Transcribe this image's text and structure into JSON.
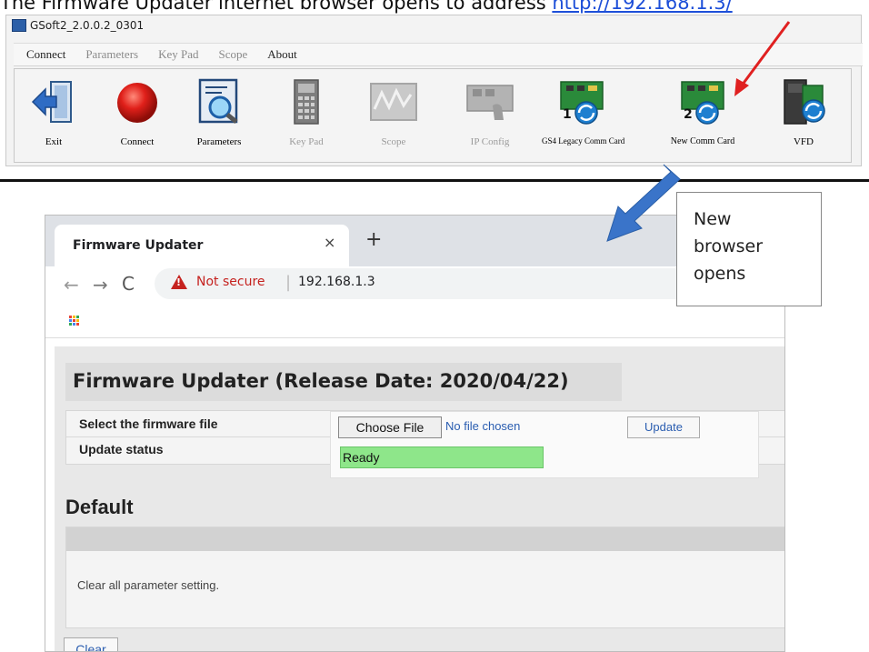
{
  "caption": {
    "text": "The Firmware Updater internet browser opens to address ",
    "link": "http://192.168.1.3/"
  },
  "gsoft": {
    "window_title": "GSoft2_2.0.0.2_0301",
    "menu": [
      {
        "label": "Connect",
        "enabled": true
      },
      {
        "label": "Parameters",
        "enabled": false
      },
      {
        "label": "Key Pad",
        "enabled": false
      },
      {
        "label": "Scope",
        "enabled": false
      },
      {
        "label": "About",
        "enabled": true
      }
    ],
    "toolbar": [
      {
        "label": "Exit",
        "icon": "exit-door-icon",
        "enabled": true
      },
      {
        "label": "Connect",
        "icon": "red-ball-icon",
        "enabled": true
      },
      {
        "label": "Parameters",
        "icon": "parameters-magnifier-icon",
        "enabled": true
      },
      {
        "label": "Key Pad",
        "icon": "keypad-icon",
        "enabled": false
      },
      {
        "label": "Scope",
        "icon": "scope-icon",
        "enabled": false
      },
      {
        "label": "IP Config",
        "icon": "ip-config-icon",
        "enabled": false
      },
      {
        "label": "GS4 Legacy Comm Card",
        "icon": "comm-card-1-icon",
        "badge": "1",
        "enabled": true
      },
      {
        "label": "New Comm Card",
        "icon": "comm-card-2-icon",
        "badge": "2",
        "enabled": true
      },
      {
        "label": "VFD",
        "icon": "vfd-icon",
        "enabled": true
      }
    ]
  },
  "browser": {
    "tab_title": "Firmware Updater",
    "tab_close": "×",
    "new_tab": "+",
    "nav": {
      "back": "←",
      "forward": "→",
      "reload": "C"
    },
    "security_label": "Not secure",
    "url": "192.168.1.3",
    "addr_separator": "|"
  },
  "page": {
    "title": "Firmware Updater (Release Date: 2020/04/22)",
    "rows": [
      {
        "label": "Select the firmware file"
      },
      {
        "label": "Update status"
      }
    ],
    "choose_file_label": "Choose File",
    "no_file_text": "No file chosen",
    "update_label": "Update",
    "status_value": "Ready",
    "default_title": "Default",
    "clear_description": "Clear all parameter setting.",
    "clear_label": "Clear"
  },
  "callout": {
    "lines": [
      "New",
      "browser",
      "opens"
    ]
  },
  "colors": {
    "status_green": "#8ee68a",
    "arrow_blue": "#3a74c9",
    "arrow_red": "#e02020",
    "warning_red": "#c5221f"
  }
}
